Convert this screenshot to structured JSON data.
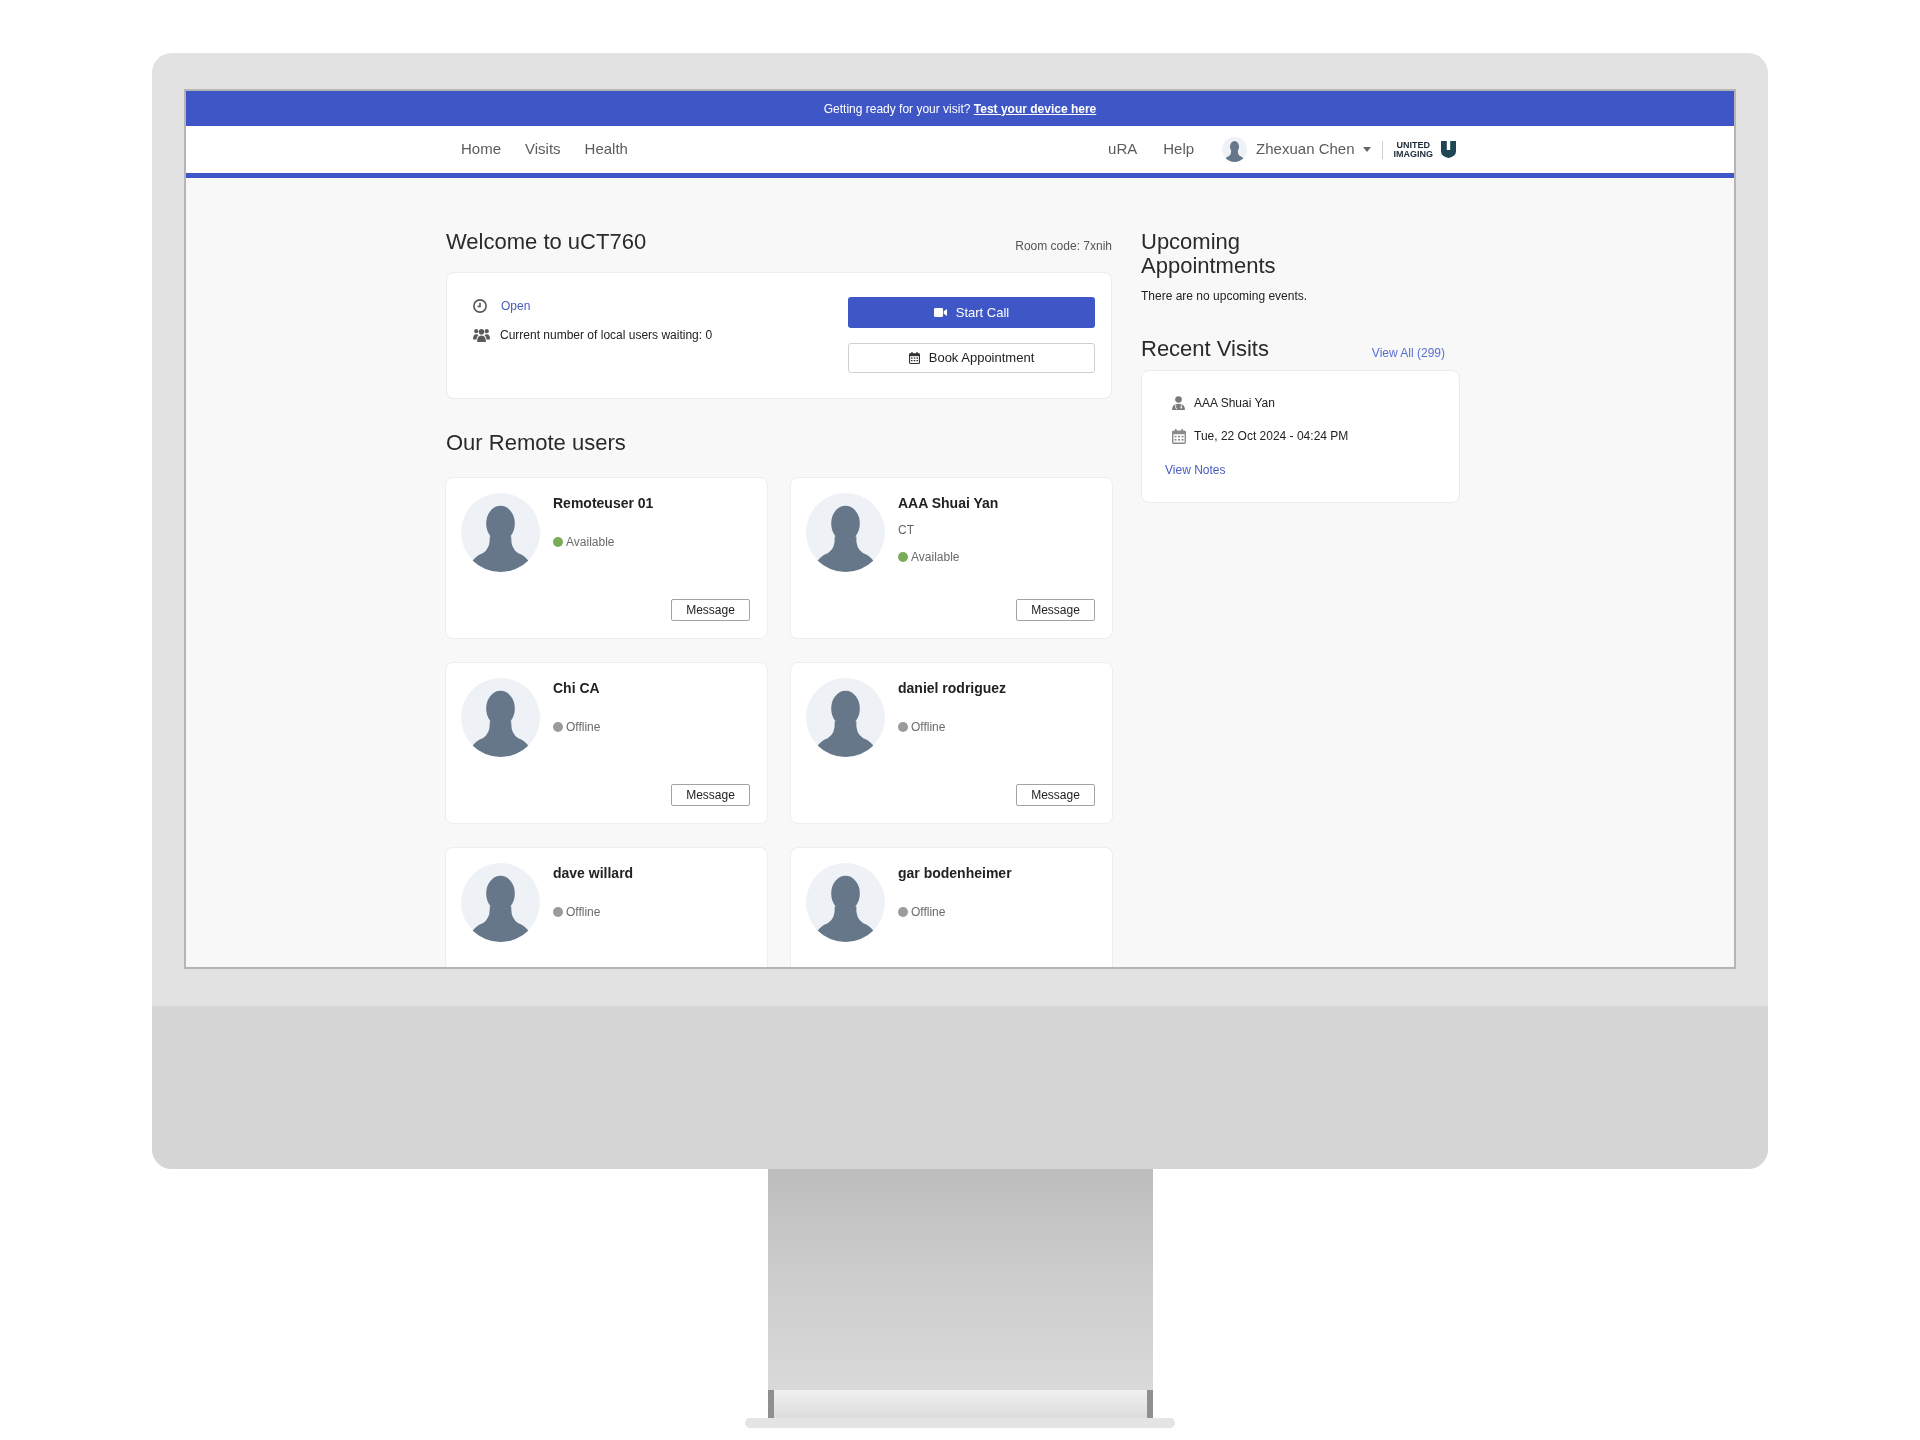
{
  "banner": {
    "text": "Getting ready for your visit?",
    "link": "Test your device here"
  },
  "nav": {
    "links": [
      "Home",
      "Visits",
      "Health"
    ],
    "right_links": [
      "uRA",
      "Help"
    ],
    "user_name": "Zhexuan Chen",
    "logo_lines": [
      "UNITED",
      "IMAGING"
    ]
  },
  "welcome": {
    "title": "Welcome to uCT760",
    "room_code": "Room code: 7xnih",
    "status": "Open",
    "waiting": "Current number of local users waiting: 0",
    "buttons": [
      {
        "label": "Start Call",
        "kind": "primary"
      },
      {
        "label": "Book Appointment",
        "kind": "secondary"
      }
    ]
  },
  "remote_users": {
    "title": "Our Remote users",
    "users": [
      {
        "name": "Remoteuser 01",
        "status": "Available",
        "color": "#7aab58",
        "action": "Message"
      },
      {
        "name": "AAA Shuai Yan",
        "role": "CT",
        "status": "Available",
        "color": "#7aab58",
        "action": "Message"
      },
      {
        "name": "Chi CA",
        "status": "Offline",
        "color": "#9b9b9b",
        "action": "Message"
      },
      {
        "name": "daniel rodriguez",
        "status": "Offline",
        "color": "#9b9b9b",
        "action": "Message"
      },
      {
        "name": "dave willard",
        "status": "Offline",
        "color": "#9b9b9b"
      },
      {
        "name": "gar bodenheimer",
        "status": "Offline",
        "color": "#9b9b9b"
      }
    ]
  },
  "upcoming": {
    "title": "Upcoming Appointments",
    "empty_text": "There are no upcoming events."
  },
  "recent_visits": {
    "title": "Recent Visits",
    "view_all": "View All (299)",
    "visits": [
      {
        "name": "AAA Shuai Yan",
        "date": "Tue, 22 Oct 2024 - 04:24 PM",
        "notes_link": "View Notes"
      }
    ]
  }
}
